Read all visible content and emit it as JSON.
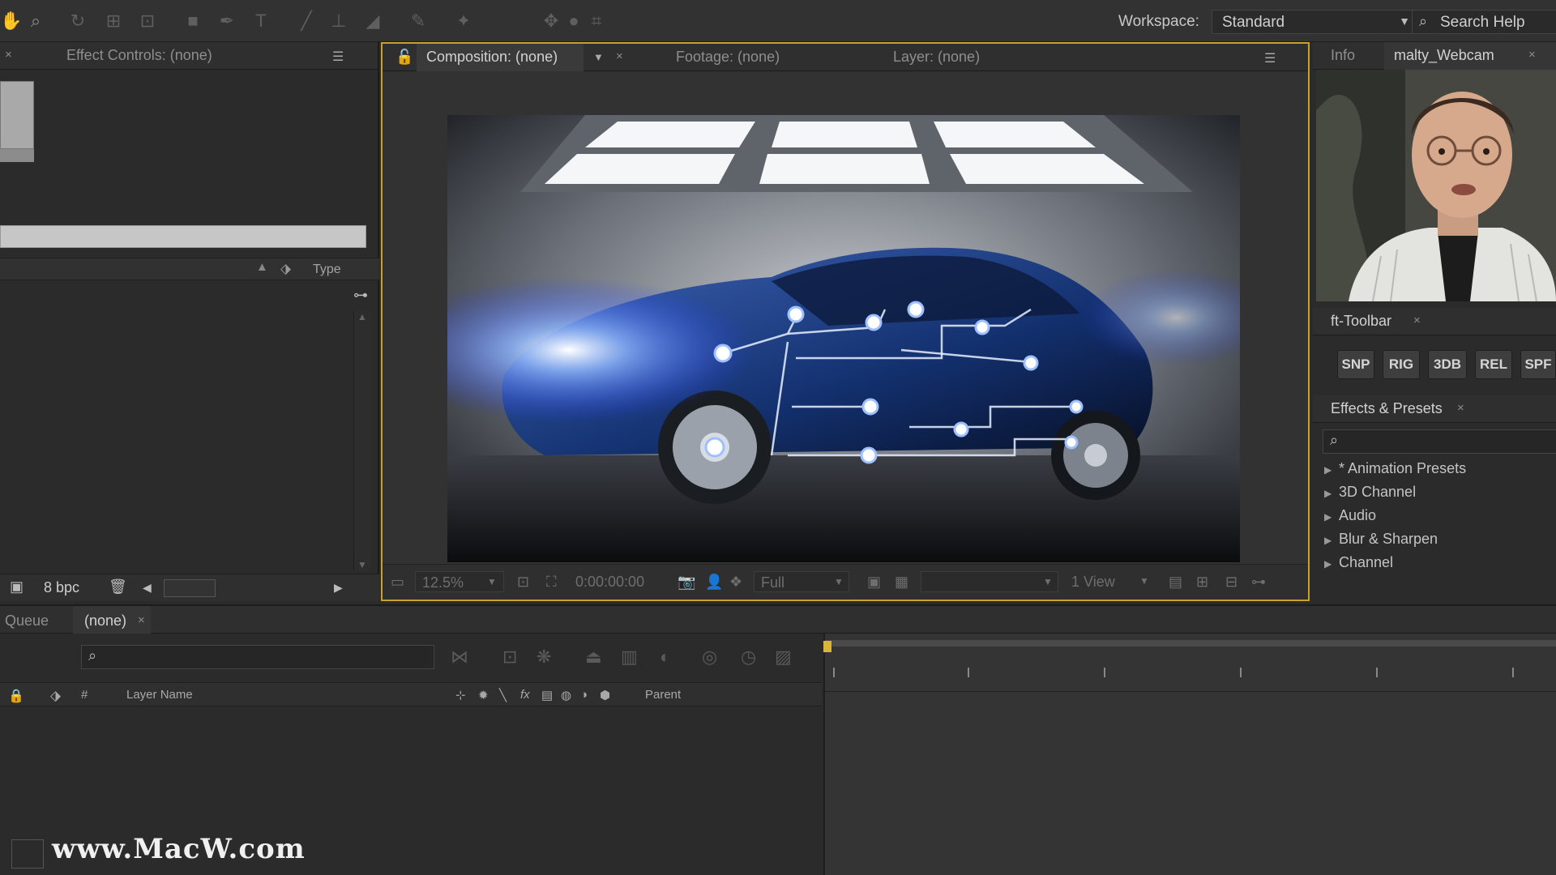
{
  "toolbar": {
    "workspace_label": "Workspace:",
    "workspace_value": "Standard",
    "search_help": "Search Help"
  },
  "left_panel": {
    "tab": "Effect Controls: (none)",
    "type_column": "Type",
    "bit_depth": "8 bpc"
  },
  "viewer": {
    "tabs": [
      "Composition: (none)",
      "Footage: (none)",
      "Layer: (none)"
    ],
    "zoom": "12.5%",
    "timecode": "0:00:00:00",
    "resolution": "Full",
    "views": "1 View"
  },
  "right_panel": {
    "tabs": [
      "Info",
      "malty_Webcam"
    ],
    "ft_toolbar": {
      "tab": "ft-Toolbar",
      "buttons": [
        "SNP",
        "RIG",
        "3DB",
        "REL",
        "SPF"
      ]
    },
    "effects_presets": {
      "tab": "Effects & Presets",
      "items": [
        "* Animation Presets",
        "3D Channel",
        "Audio",
        "Blur & Sharpen",
        "Channel"
      ]
    }
  },
  "timeline": {
    "tabs": [
      "Queue",
      "(none)"
    ],
    "columns": {
      "hash": "#",
      "layer_name": "Layer Name",
      "parent": "Parent"
    }
  },
  "watermark": "www.MacW.com",
  "colors": {
    "panel_bg": "#2b2b2b",
    "active_panel_border": "#c8a02c",
    "playhead": "#d9b636"
  }
}
